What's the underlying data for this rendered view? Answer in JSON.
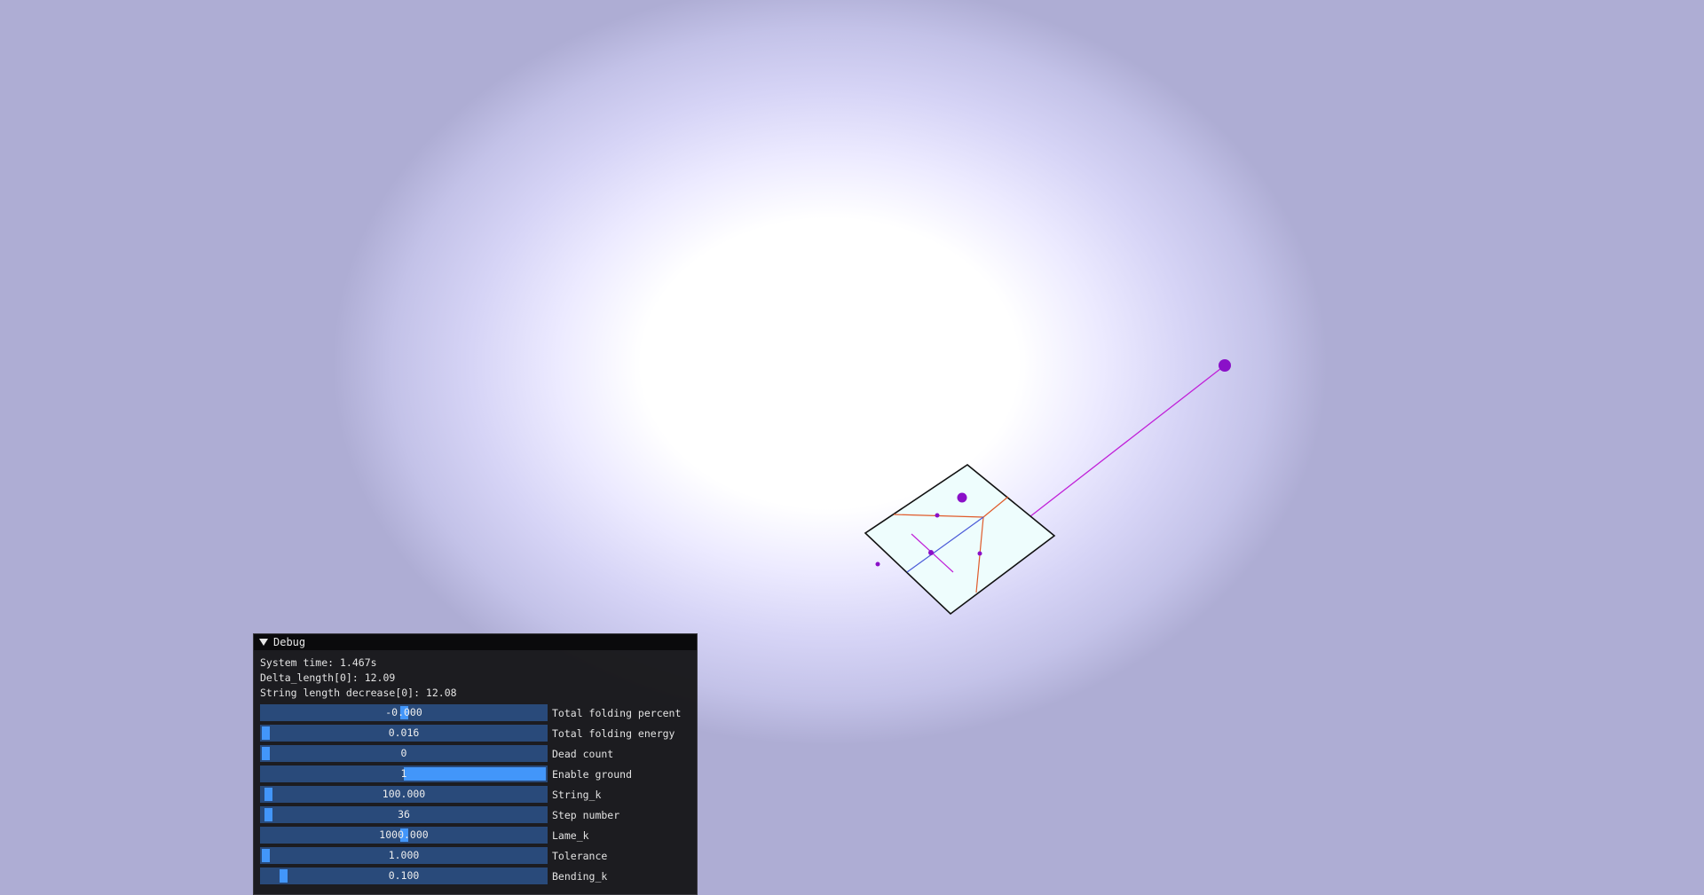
{
  "window": {
    "title": "Debug",
    "collapsed": false
  },
  "stats": {
    "system_time": "System time: 1.467s",
    "delta_length": "Delta_length[0]: 12.09",
    "string_length_decrease": "String length decrease[0]: 12.08"
  },
  "sliders": [
    {
      "label": "Total folding percent",
      "value": "-0.000",
      "fill": 0.5
    },
    {
      "label": "Total folding energy",
      "value": "0.016",
      "fill": 0.0
    },
    {
      "label": "Dead count",
      "value": "0",
      "fill": 0.0
    },
    {
      "label": "Enable ground",
      "value": "1",
      "fill": 1.0
    },
    {
      "label": "String_k",
      "value": "100.000",
      "fill": 0.01
    },
    {
      "label": "Step number",
      "value": "36",
      "fill": 0.01
    },
    {
      "label": "Lame_k",
      "value": "1000.000",
      "fill": 0.5
    },
    {
      "label": "Tolerance",
      "value": "1.000",
      "fill": 0.0
    },
    {
      "label": "Bending_k",
      "value": "0.100",
      "fill": 0.065
    }
  ],
  "colors": {
    "slider_bg": "#294a7a",
    "slider_grab": "#4296fa",
    "paper": "#eefdfd",
    "crease_mountain": "#e05a2a",
    "crease_valley": "#4a5ad8",
    "particle": "#8a10c8",
    "string": "#c020d8"
  },
  "icons": {
    "collapse": "triangle-down-icon"
  }
}
